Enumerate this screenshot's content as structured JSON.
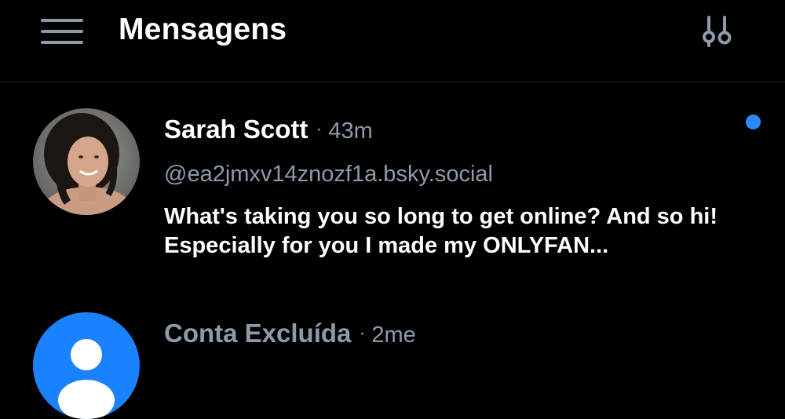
{
  "header": {
    "title": "Mensagens",
    "menu_icon": "hamburger-menu-icon",
    "filter_icon": "settings-sliders-icon"
  },
  "colors": {
    "background": "#000000",
    "muted_text": "#8e9aab",
    "accent": "#2b8aff",
    "divider": "#1e2530"
  },
  "conversations": [
    {
      "name": "Sarah Scott",
      "separator": "·",
      "time": "43m",
      "handle": "@ea2jmxv14znozf1a.bsky.social",
      "preview": "What's taking you so long to get online? And so hi! Especially for you I made my ONLYFAN...",
      "unread": true,
      "avatar": "user-photo-avatar"
    },
    {
      "name": "Conta Excluída",
      "separator": "·",
      "time": "2me",
      "avatar": "default-user-avatar",
      "deleted": true
    }
  ]
}
